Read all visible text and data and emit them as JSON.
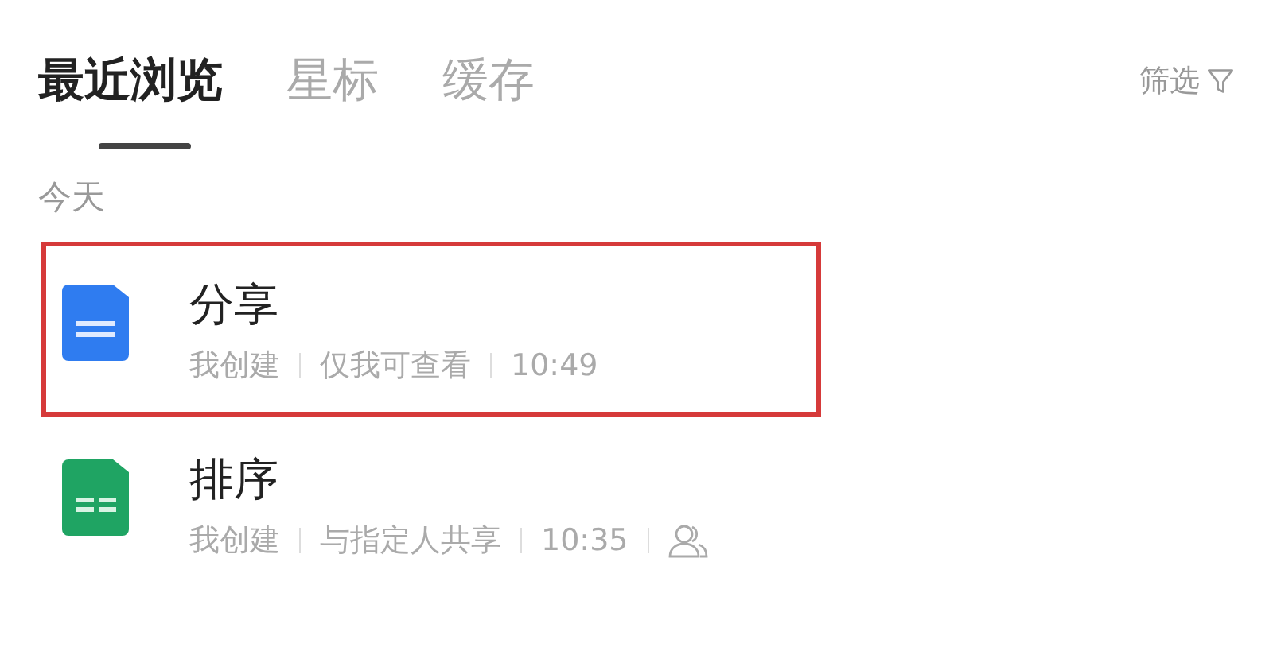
{
  "tabs": [
    {
      "label": "最近浏览",
      "selected": true
    },
    {
      "label": "星标",
      "selected": false
    },
    {
      "label": "缓存",
      "selected": false
    }
  ],
  "filter": {
    "label": "筛选"
  },
  "section": {
    "title": "今天"
  },
  "files": [
    {
      "kind": "doc",
      "name": "分享",
      "meta": [
        "我创建",
        "仅我可查看",
        "10:49"
      ],
      "shared": false,
      "highlighted": true
    },
    {
      "kind": "sheet",
      "name": "排序",
      "meta": [
        "我创建",
        "与指定人共享",
        "10:35"
      ],
      "shared": true,
      "highlighted": false
    }
  ]
}
